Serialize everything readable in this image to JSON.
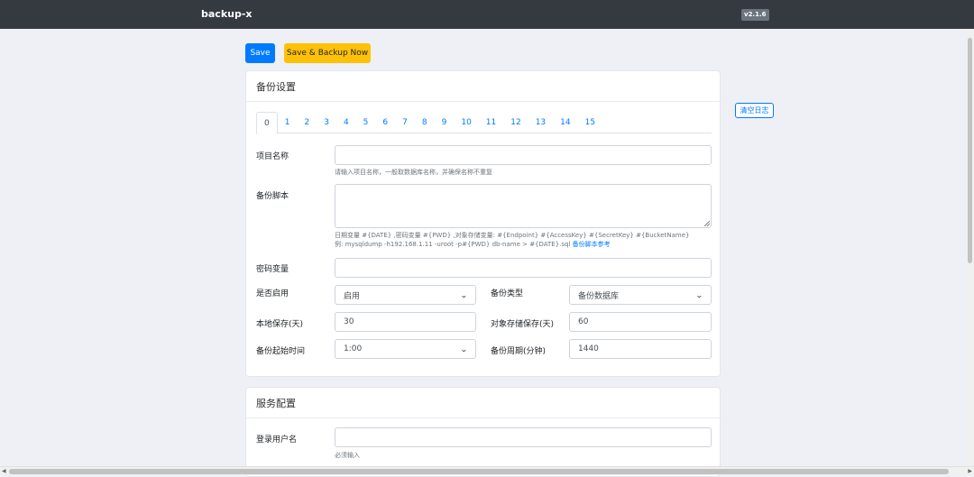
{
  "navbar": {
    "brand": "backup-x",
    "version": "v2.1.6"
  },
  "actions": {
    "save": "Save",
    "save_backup": "Save & Backup Now",
    "clear_log": "清空日志"
  },
  "backup": {
    "title": "备份设置",
    "tabs": [
      "0",
      "1",
      "2",
      "3",
      "4",
      "5",
      "6",
      "7",
      "8",
      "9",
      "10",
      "11",
      "12",
      "13",
      "14",
      "15"
    ],
    "active_tab": "0",
    "project_name_label": "项目名称",
    "project_name_value": "",
    "project_name_help": "请输入项目名称，一般取数据库名称，并确保名称不重复",
    "script_label": "备份脚本",
    "script_value": "",
    "script_help_1": "日期变量 #{DATE} ,密码变量 #{PWD} ,对象存储变量: #{Endpoint} #{AccessKey} #{SecretKey} #{BucketName}",
    "script_help_2": "例: mysqldump -h192.168.1.11 -uroot -p#{PWD} db-name > #{DATE}.sql",
    "script_help_link": "备份脚本参考",
    "password_label": "密码变量",
    "password_value": "",
    "enabled_label": "是否启用",
    "enabled_value": "启用",
    "type_label": "备份类型",
    "type_value": "备份数据库",
    "local_keep_label": "本地保存(天)",
    "local_keep_value": "30",
    "object_keep_label": "对象存储保存(天)",
    "object_keep_value": "60",
    "start_time_label": "备份起始时间",
    "start_time_value": "1:00",
    "period_label": "备份周期(分钟)",
    "period_value": "1440"
  },
  "service": {
    "title": "服务配置",
    "username_label": "登录用户名",
    "username_value": "",
    "username_help": "必须输入"
  },
  "colors": {
    "primary": "#007bff",
    "warning": "#ffc107",
    "navbar": "#343a40",
    "background": "#eef0f5"
  }
}
